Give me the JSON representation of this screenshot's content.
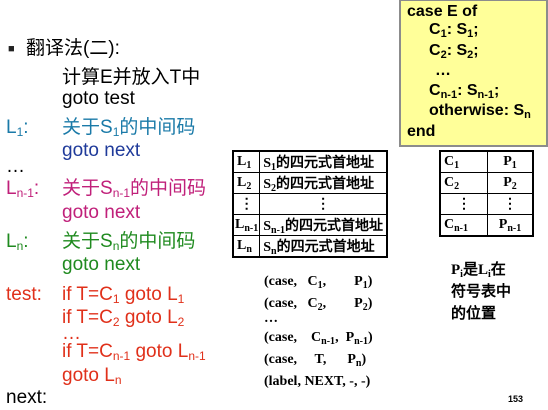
{
  "heading": {
    "bullet": "■",
    "text": "翻译法(二):"
  },
  "lines": [
    {
      "label": "",
      "text": "计算E并放入T中"
    },
    {
      "label": "",
      "text": "goto test"
    }
  ],
  "l1": {
    "label": "L1:",
    "text": "关于S1的中间码",
    "goto": "goto next"
  },
  "ellipsis1": "…",
  "ln1": {
    "label": "Ln-1:",
    "text": "关于Sn-1的中间码",
    "goto": "goto next"
  },
  "ln": {
    "label": "Ln:",
    "text": "关于Sn的中间码",
    "goto": "goto next"
  },
  "test": {
    "label": "test:",
    "lines": [
      "if T=C1 goto L1",
      "if T=C2 goto L2",
      "…",
      "if T=Cn-1 goto Ln-1",
      "goto Ln"
    ]
  },
  "next": {
    "label": "next:"
  },
  "case_box": {
    "line1": "case  E  of",
    "line2": "C1: S1;",
    "line3": "C2: S2;",
    "line4": "…",
    "line5": "Cn-1: Sn-1;",
    "line6": "otherwise: Sn",
    "line7": "end"
  },
  "table_left": [
    {
      "l": "L1",
      "desc": "S1的四元式首地址"
    },
    {
      "l": "L2",
      "desc": "S2的四元式首地址"
    },
    {
      "l": "⋮",
      "desc": "⋮"
    },
    {
      "l": "Ln-1",
      "desc": "Sn-1的四元式首地址"
    },
    {
      "l": "Ln",
      "desc": "Sn的四元式首地址"
    }
  ],
  "table_right": [
    {
      "c": "C1",
      "p": "P1"
    },
    {
      "c": "C2",
      "p": "P2"
    },
    {
      "c": "⋮",
      "p": "⋮"
    },
    {
      "c": "Cn-1",
      "p": "Pn-1"
    }
  ],
  "quads": [
    "(case,  C1,      P1)",
    "(case,  C2,      P2)",
    "…",
    "(case,   Cn-1,  Pn-1)",
    "(case,    T,     Pn)",
    "(label,  NEXT,  -, -)"
  ],
  "note": {
    "line1": "Pi是Li在",
    "line2": "符号表中",
    "line3": "的位置"
  },
  "page_number": "153"
}
